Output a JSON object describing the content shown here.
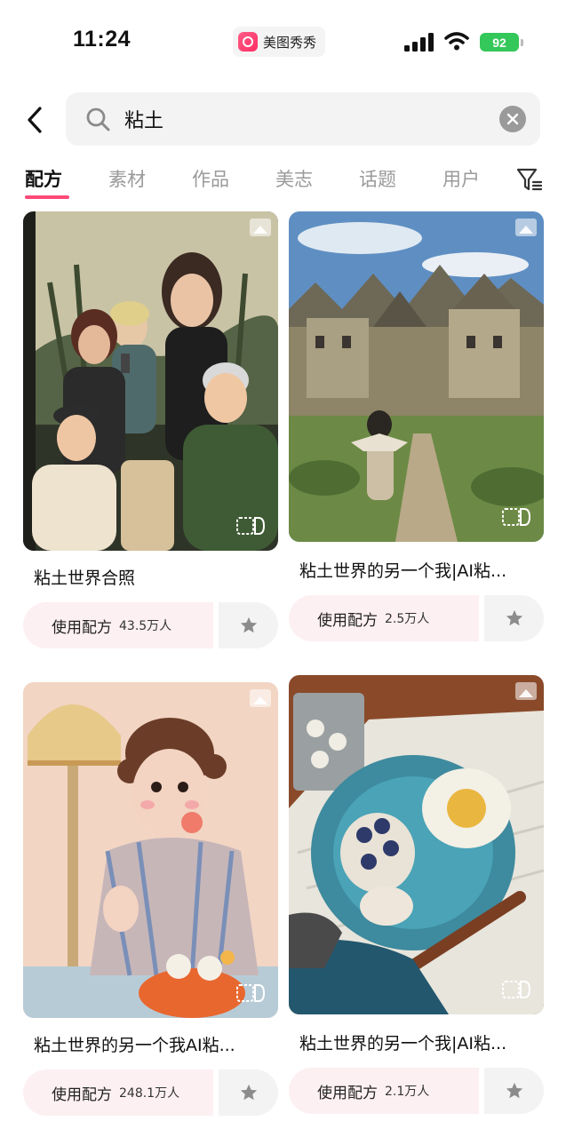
{
  "status_bar": {
    "time": "11:24",
    "app_name": "美图秀秀",
    "battery": "92",
    "battery_color": "#34c759"
  },
  "search": {
    "query": "粘土",
    "back_icon": "chevron-left-icon",
    "search_icon": "search-icon",
    "clear_icon": "clear-icon"
  },
  "tabs": [
    {
      "label": "配方",
      "active": true
    },
    {
      "label": "素材",
      "active": false
    },
    {
      "label": "作品",
      "active": false
    },
    {
      "label": "美志",
      "active": false
    },
    {
      "label": "话题",
      "active": false
    },
    {
      "label": "用户",
      "active": false
    }
  ],
  "accent_color": "#ff4a78",
  "cards": [
    {
      "title": "粘土世界合照",
      "use_label": "使用配方",
      "count": "43.5万人"
    },
    {
      "title": "粘土世界的另一个我|AI粘...",
      "use_label": "使用配方",
      "count": "2.5万人"
    },
    {
      "title": "粘土世界的另一个我AI粘...",
      "use_label": "使用配方",
      "count": "248.1万人"
    },
    {
      "title": "粘土世界的另一个我|AI粘...",
      "use_label": "使用配方",
      "count": "2.1万人"
    }
  ]
}
